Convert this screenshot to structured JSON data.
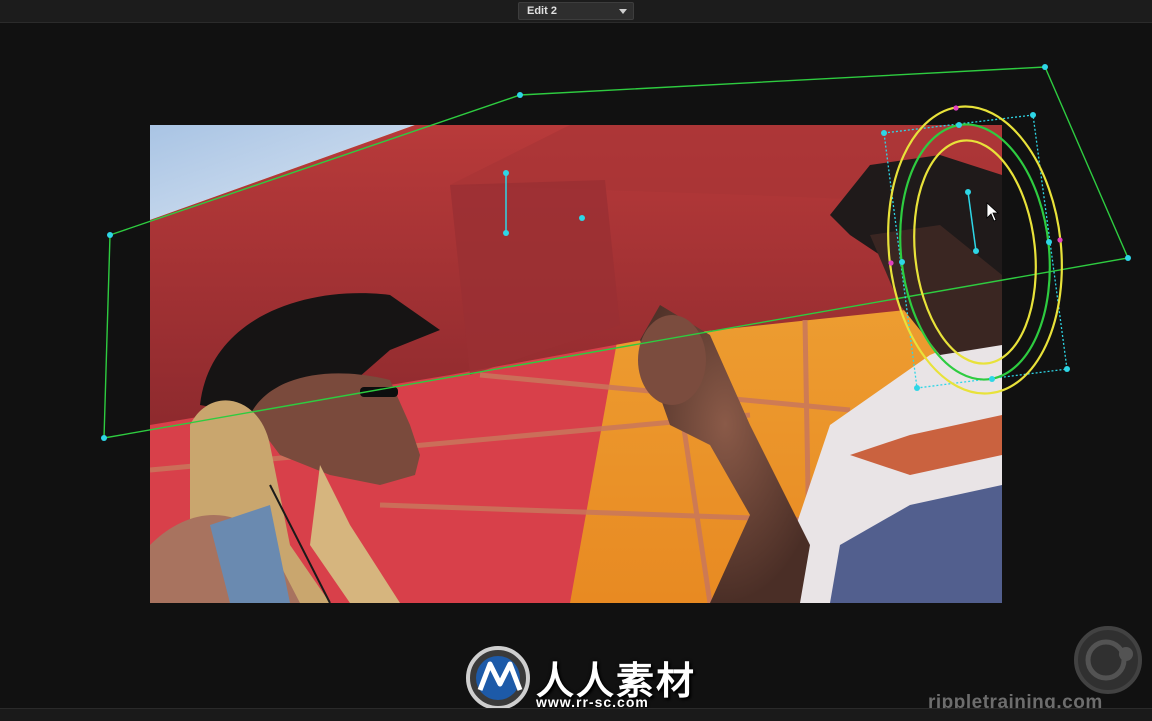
{
  "viewer": {
    "clip_selector": {
      "value": "Edit 2"
    }
  },
  "controls": {
    "linear_window_color": "#2ecc40",
    "circular_outer_color": "#e8e23a",
    "circular_softness_color": "#2ecc40",
    "control_point_color": "#2ed6e6",
    "softness_point_color": "#e040c0"
  },
  "icons": {
    "cursor": "pointer-arrow-icon",
    "dropdown": "chevron-down-icon",
    "watermark_logo": "rr-sc-logo",
    "ripple_logo": "ripple-training-logo"
  },
  "watermarks": {
    "site_name": "人人素材",
    "site_url": "www.rr-sc.com",
    "brand": "rippletraining.com"
  }
}
